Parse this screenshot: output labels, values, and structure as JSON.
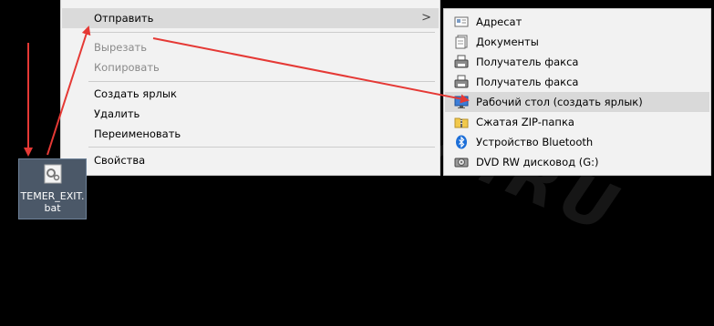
{
  "context_menu": {
    "items": [
      {
        "label": "Отправить",
        "state": "highlighted",
        "has_submenu": true
      },
      {
        "label": "Вырезать",
        "state": "disabled"
      },
      {
        "label": "Копировать",
        "state": "disabled"
      },
      {
        "label": "Создать ярлык",
        "state": "normal"
      },
      {
        "label": "Удалить",
        "state": "normal"
      },
      {
        "label": "Переименовать",
        "state": "normal"
      },
      {
        "label": "Свойства",
        "state": "normal"
      }
    ],
    "submenu_arrow": ">"
  },
  "send_to_menu": {
    "items": [
      {
        "label": "Адресат",
        "icon": "contact-icon"
      },
      {
        "label": "Документы",
        "icon": "documents-icon"
      },
      {
        "label": "Получатель факса",
        "icon": "fax-icon"
      },
      {
        "label": "Получатель факса",
        "icon": "fax-icon"
      },
      {
        "label": "Рабочий стол (создать ярлык)",
        "icon": "desktop-icon",
        "state": "highlighted"
      },
      {
        "label": "Сжатая ZIP-папка",
        "icon": "zip-folder-icon"
      },
      {
        "label": "Устройство Bluetooth",
        "icon": "bluetooth-icon"
      },
      {
        "label": "DVD RW дисковод (G:)",
        "icon": "dvd-drive-icon"
      }
    ]
  },
  "desktop_file": {
    "name_line1": "TEMER_EXIT.",
    "name_line2": "bat",
    "icon": "batch-file-gear-icon"
  },
  "watermark": "MARREX.RU",
  "colors": {
    "annotation_arrow": "#e53935",
    "menu_bg": "#f2f2f2",
    "highlight": "#dadada",
    "file_selection": "#4b5868"
  }
}
